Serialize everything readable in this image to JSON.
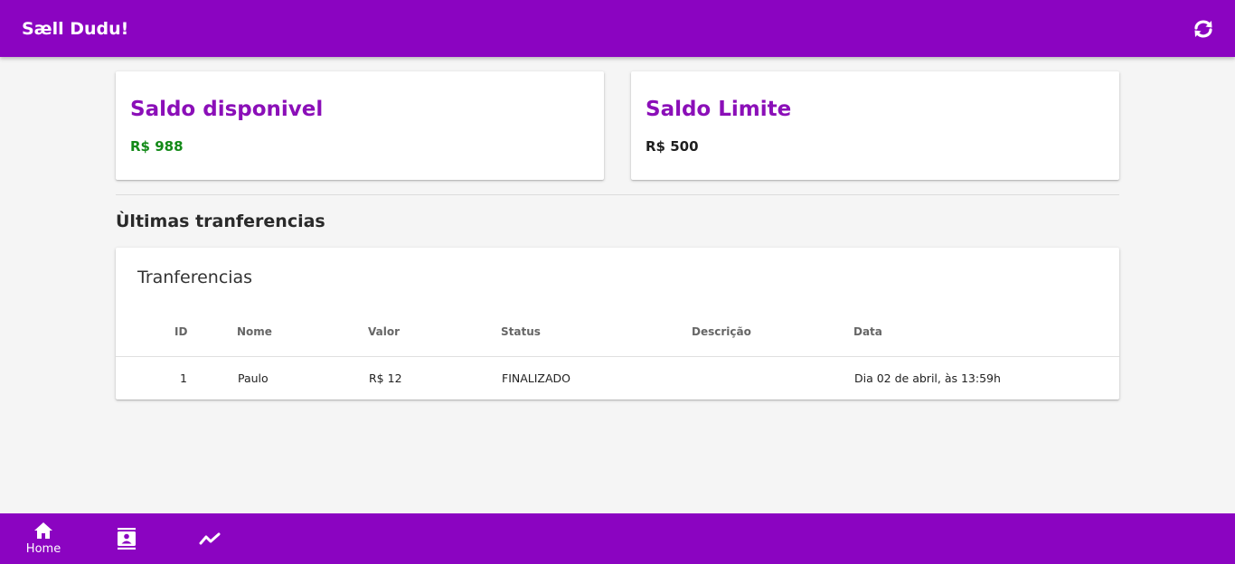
{
  "header": {
    "title": "Sæll Dudu!",
    "refresh_icon": "refresh-icon"
  },
  "balances": {
    "available": {
      "title": "Saldo disponivel",
      "value": "R$ 988",
      "color": "#138a18"
    },
    "limit": {
      "title": "Saldo Limite",
      "value": "R$ 500",
      "color": "#1f1f1f"
    }
  },
  "section": {
    "title": "Ùltimas tranferencias"
  },
  "transfers": {
    "title": "Tranferencias",
    "columns": [
      "ID",
      "Nome",
      "Valor",
      "Status",
      "Descrição",
      "Data"
    ],
    "rows": [
      {
        "id": "1",
        "nome": "Paulo",
        "valor": "R$ 12",
        "status": "FINALIZADO",
        "descricao": "",
        "data": "Dia 02 de abril, às 13:59h"
      }
    ]
  },
  "bottom_nav": {
    "home_label": "Home",
    "items": [
      "home-icon",
      "contacts-icon",
      "trending-icon"
    ]
  },
  "colors": {
    "primary": "#8b04c1",
    "accent_text": "#8b0fb8",
    "positive": "#138a18"
  }
}
